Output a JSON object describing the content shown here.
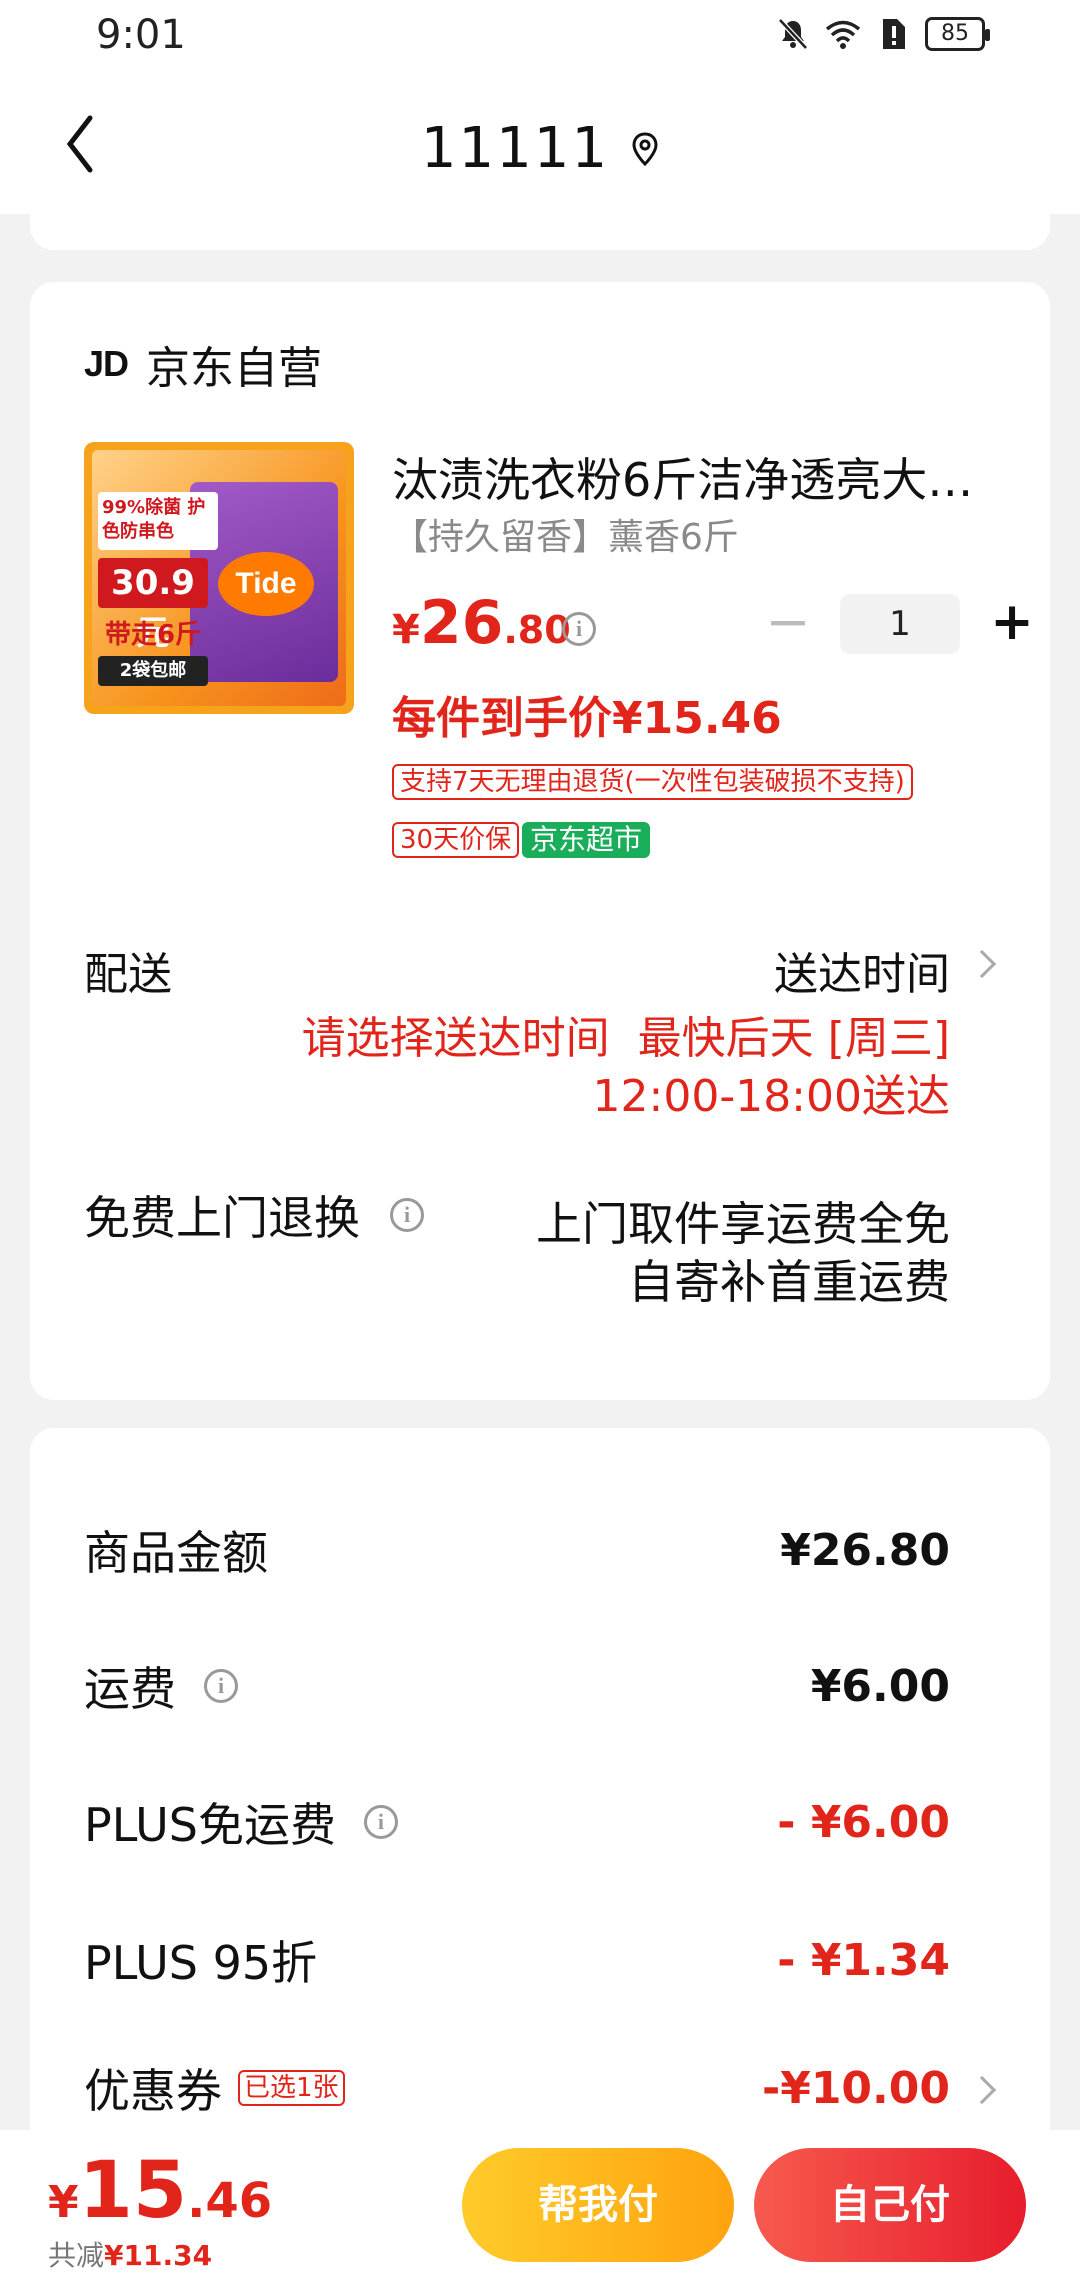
{
  "status": {
    "time": "9:01",
    "battery": "85"
  },
  "header": {
    "title": "11111"
  },
  "shop": {
    "logo": "JD",
    "name": "京东自营"
  },
  "product": {
    "title": "汰渍洗衣粉6斤洁净透亮大…",
    "spec": "【持久留香】薰香6斤",
    "price_yen": "¥",
    "price_int": "26",
    "price_dec": ".80",
    "quantity": "1",
    "unit_price": "每件到手价¥15.46",
    "tags": {
      "return": "支持7天无理由退货(一次性包装破损不支持)",
      "price_protect": "30天价保",
      "store": "京东超市"
    },
    "image_text": {
      "badge1": "99%除菌 护色防串色",
      "price": "30.9元",
      "carry": "带走6斤",
      "bottom": "2袋包邮",
      "brand": "Tide"
    }
  },
  "shipping": {
    "label": "配送",
    "value": "送达时间",
    "hint_a": "请选择送达时间",
    "hint_b": "最快后天 [周三]",
    "hint_c": "12:00-18:00送达"
  },
  "returns": {
    "label": "免费上门退换",
    "line1": "上门取件享运费全免",
    "line2": "自寄补首重运费"
  },
  "price_detail": {
    "goods_label": "商品金额",
    "goods_value": "¥26.80",
    "freight_label": "运费",
    "freight_value": "¥6.00",
    "plus_free_label": "PLUS免运费",
    "plus_free_value": "- ¥6.00",
    "plus_discount_label": "PLUS 95折",
    "plus_discount_value": "- ¥1.34",
    "coupon_label": "优惠券",
    "coupon_tag": "已选1张",
    "coupon_value": "-¥10.00"
  },
  "bottom": {
    "total_yen": "¥",
    "total_int": "15",
    "total_dec": ".46",
    "saved_label": "共减",
    "saved_value": "¥11.34",
    "help_pay": "帮我付",
    "self_pay": "自己付"
  },
  "colors": {
    "accent": "#e1251b",
    "green": "#1aad5a",
    "yellow": "#ffb31a"
  }
}
